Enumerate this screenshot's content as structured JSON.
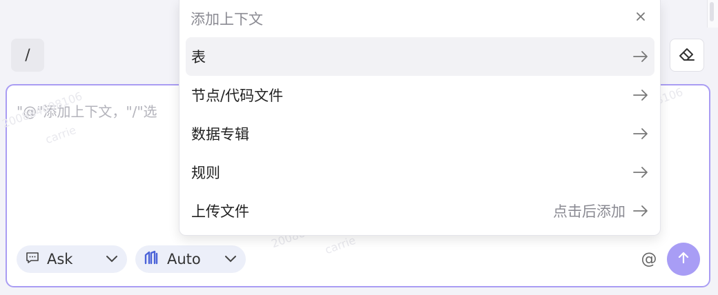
{
  "toolbar": {
    "slash_label": "/"
  },
  "composer": {
    "placeholder": "\"@\"添加上下文，\"/\"选",
    "watermark_lines": [
      "200884698106",
      "carrie"
    ],
    "mode_label": "Ask",
    "model_label": "Auto",
    "at_label": "@"
  },
  "context_menu": {
    "title": "添加上下文",
    "items": [
      {
        "label": "表",
        "hint": ""
      },
      {
        "label": "节点/代码文件",
        "hint": ""
      },
      {
        "label": "数据专辑",
        "hint": ""
      },
      {
        "label": "规则",
        "hint": ""
      },
      {
        "label": "上传文件",
        "hint": "点击后添加"
      }
    ]
  },
  "colors": {
    "accent_border": "#a99cf3",
    "send_button": "#a89df5",
    "model_icon": "#4b63d8"
  }
}
